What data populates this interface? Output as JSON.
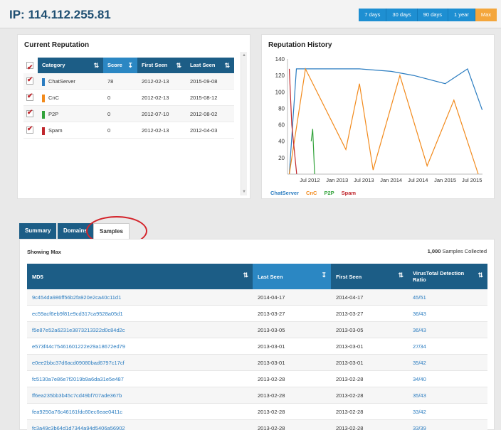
{
  "header": {
    "title": "IP: 114.112.255.81",
    "ranges": [
      "7 days",
      "30 days",
      "90 days",
      "1 year",
      "Max"
    ],
    "active_range": "Max"
  },
  "reputation": {
    "title": "Current Reputation",
    "columns": [
      "Category",
      "Score",
      "First Seen",
      "Last Seen"
    ],
    "rows": [
      {
        "category": "ChatServer",
        "score": "78",
        "first_seen": "2012-02-13",
        "last_seen": "2015-09-08",
        "color": "#2a7cc0"
      },
      {
        "category": "CnC",
        "score": "0",
        "first_seen": "2012-02-13",
        "last_seen": "2015-08-12",
        "color": "#f28a1c"
      },
      {
        "category": "P2P",
        "score": "0",
        "first_seen": "2012-07-10",
        "last_seen": "2012-08-02",
        "color": "#31a23a"
      },
      {
        "category": "Spam",
        "score": "0",
        "first_seen": "2012-02-13",
        "last_seen": "2012-04-03",
        "color": "#c0272d"
      }
    ]
  },
  "history": {
    "title": "Reputation History",
    "y_ticks": [
      "140",
      "120",
      "100",
      "80",
      "60",
      "40",
      "20"
    ],
    "x_ticks": [
      "Jul 2012",
      "Jan 2013",
      "Jul 2013",
      "Jan 2014",
      "Jul 2014",
      "Jan 2015",
      "Jul 2015"
    ],
    "legend": [
      {
        "label": "ChatServer",
        "color": "#2a7cc0"
      },
      {
        "label": "CnC",
        "color": "#f28a1c"
      },
      {
        "label": "P2P",
        "color": "#31a23a"
      },
      {
        "label": "Spam",
        "color": "#c0272d"
      }
    ]
  },
  "chart_data": {
    "type": "line",
    "title": "Reputation History",
    "ylim": [
      0,
      140
    ],
    "x_tick_labels": [
      "Jul 2012",
      "Jan 2013",
      "Jul 2013",
      "Jan 2014",
      "Jul 2014",
      "Jan 2015",
      "Jul 2015"
    ],
    "series": [
      {
        "name": "ChatServer",
        "x": [
          "2012-02-13",
          "2012-04-01",
          "2013-01-01",
          "2013-06-01",
          "2014-01-01",
          "2014-06-01",
          "2015-01-01",
          "2015-06-01",
          "2015-09-08"
        ],
        "values": [
          0,
          128,
          128,
          128,
          125,
          120,
          110,
          128,
          78
        ]
      },
      {
        "name": "CnC",
        "x": [
          "2012-02-13",
          "2012-06-01",
          "2013-03-01",
          "2013-06-01",
          "2013-09-01",
          "2014-03-01",
          "2014-09-01",
          "2015-03-01",
          "2015-08-12"
        ],
        "values": [
          0,
          128,
          30,
          110,
          5,
          120,
          10,
          90,
          0
        ]
      },
      {
        "name": "P2P",
        "x": [
          "2012-07-10",
          "2012-07-20",
          "2012-08-02"
        ],
        "values": [
          40,
          55,
          0
        ]
      },
      {
        "name": "Spam",
        "x": [
          "2012-02-13",
          "2012-03-01",
          "2012-04-03"
        ],
        "values": [
          128,
          60,
          0
        ]
      }
    ]
  },
  "tabs": [
    "Summary",
    "Domains",
    "Samples"
  ],
  "active_tab": "Samples",
  "samples": {
    "showing": "Showing Max",
    "count": "1,000",
    "count_suffix": "Samples Collected",
    "columns": [
      "MD5",
      "Last Seen",
      "First Seen",
      "VirusTotal Detection Ratio"
    ],
    "rows": [
      {
        "md5": "9c454da986ff56b2fa920e2ca40c11d1",
        "last": "2014-04-17",
        "first": "2014-04-17",
        "ratio": "45/51"
      },
      {
        "md5": "ec59acf6eb9f81e9cd317ca9528a05d1",
        "last": "2013-03-27",
        "first": "2013-03-27",
        "ratio": "36/43"
      },
      {
        "md5": "f5e87e52a6231e3873213322d0c84d2c",
        "last": "2013-03-05",
        "first": "2013-03-05",
        "ratio": "36/43"
      },
      {
        "md5": "e573f44c75461601222e29a18672ed79",
        "last": "2013-03-01",
        "first": "2013-03-01",
        "ratio": "27/34"
      },
      {
        "md5": "e0ee2bbc37d6acd09080bad6797c17cf",
        "last": "2013-03-01",
        "first": "2013-03-01",
        "ratio": "35/42"
      },
      {
        "md5": "fc5130a7e86e7f2019b9a6da31e5e487",
        "last": "2013-02-28",
        "first": "2013-02-28",
        "ratio": "34/40"
      },
      {
        "md5": "ff6ea235bb3b45c7cd49bf707ade367b",
        "last": "2013-02-28",
        "first": "2013-02-28",
        "ratio": "35/43"
      },
      {
        "md5": "fea9250a76c46161fdc60ec6eae0411c",
        "last": "2013-02-28",
        "first": "2013-02-28",
        "ratio": "33/42"
      },
      {
        "md5": "fc3a49c3b64d1d7344a94d5406a56902",
        "last": "2013-02-28",
        "first": "2013-02-28",
        "ratio": "33/39"
      }
    ]
  }
}
